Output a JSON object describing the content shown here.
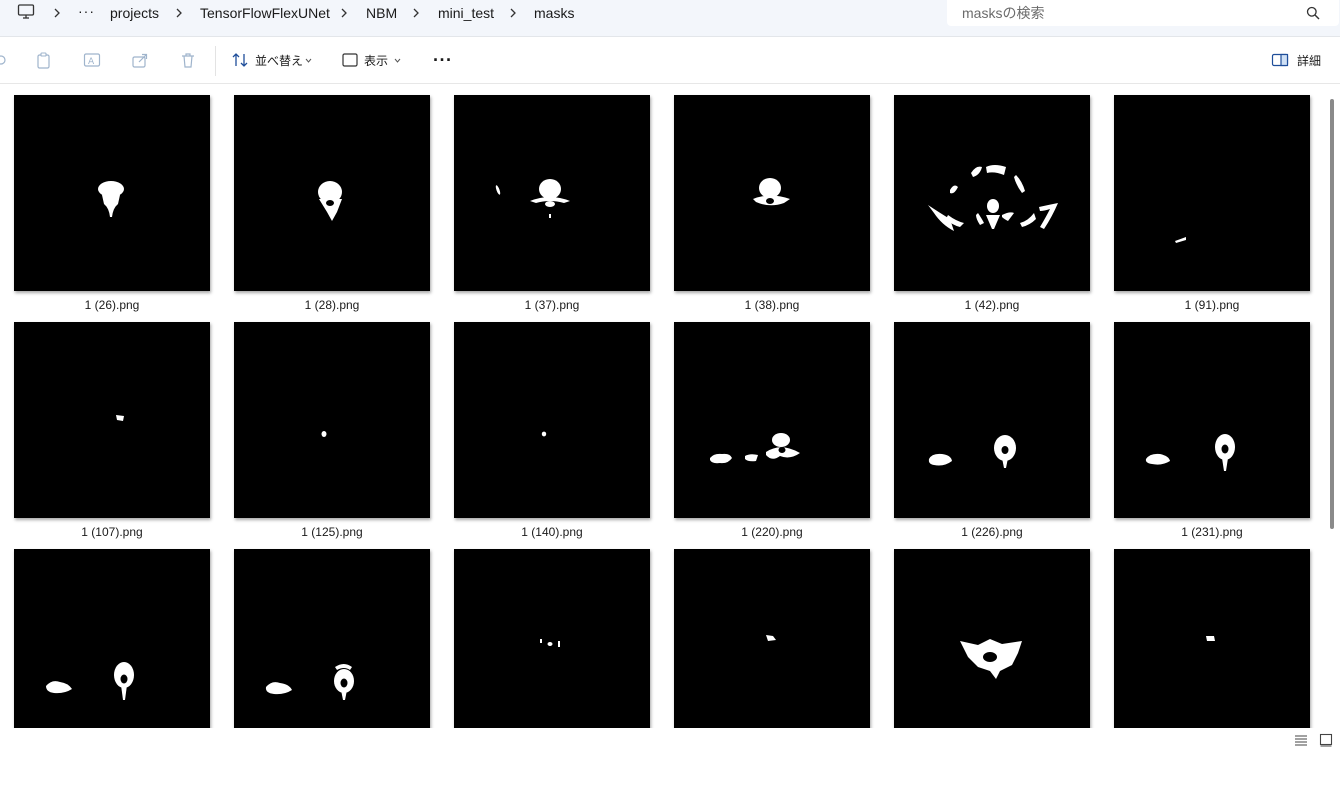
{
  "address": {
    "computer_icon": "computer-icon",
    "overflow": "···",
    "crumbs": [
      "projects",
      "TensorFlowFlexUNet",
      "NBM",
      "mini_test",
      "masks"
    ]
  },
  "search": {
    "placeholder": "masksの検索",
    "icon": "search-icon"
  },
  "toolbar": {
    "sort_label": "並べ替え",
    "view_label": "表示",
    "more": "···",
    "details_label": "詳細",
    "icons": [
      "cut-icon",
      "copy-icon",
      "rename-icon",
      "share-icon",
      "delete-icon"
    ]
  },
  "files": [
    {
      "name": "1 (26).png"
    },
    {
      "name": "1 (28).png"
    },
    {
      "name": "1 (37).png"
    },
    {
      "name": "1 (38).png"
    },
    {
      "name": "1 (42).png"
    },
    {
      "name": "1 (91).png"
    },
    {
      "name": "1 (107).png"
    },
    {
      "name": "1 (125).png"
    },
    {
      "name": "1 (140).png"
    },
    {
      "name": "1 (220).png"
    },
    {
      "name": "1 (226).png"
    },
    {
      "name": "1 (231).png"
    },
    {
      "name": ""
    },
    {
      "name": ""
    },
    {
      "name": ""
    },
    {
      "name": ""
    },
    {
      "name": ""
    },
    {
      "name": ""
    }
  ],
  "statusbar": {
    "icons": [
      "details-view-icon",
      "large-icons-view-icon"
    ]
  },
  "colors": {
    "accent": "#0067c0",
    "mask_bg": "#000000",
    "mask_fg": "#ffffff"
  }
}
